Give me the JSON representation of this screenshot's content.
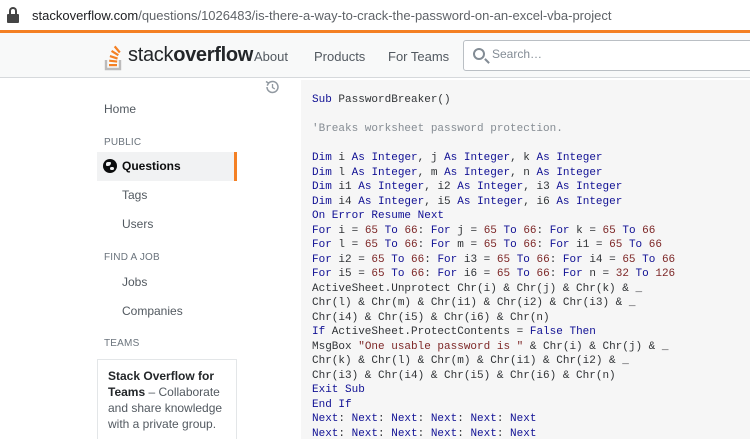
{
  "browser": {
    "url_host": "stackoverflow.com",
    "url_path": "/questions/1026483/is-there-a-way-to-crack-the-password-on-an-excel-vba-project"
  },
  "header": {
    "logo_light": "stack",
    "logo_bold": "overflow",
    "nav": [
      "About",
      "Products",
      "For Teams"
    ],
    "search_placeholder": "Search…",
    "accent": "#f48024"
  },
  "sidebar": {
    "home": "Home",
    "public_heading": "PUBLIC",
    "questions": "Questions",
    "tags": "Tags",
    "users": "Users",
    "find_job_heading": "FIND A JOB",
    "jobs": "Jobs",
    "companies": "Companies",
    "teams_heading": "TEAMS",
    "teams_title": "Stack Overflow for Teams",
    "teams_text": " – Collaborate and share knowledge with a private group."
  },
  "code_lines": [
    [
      [
        "kw",
        "Sub"
      ],
      [
        "fn",
        " PasswordBreaker()"
      ]
    ],
    [],
    [
      [
        "com",
        "'Breaks worksheet password protection."
      ]
    ],
    [],
    [
      [
        "kw",
        "Dim"
      ],
      [
        "fn",
        " i "
      ],
      [
        "kw",
        "As"
      ],
      [
        "fn",
        " "
      ],
      [
        "kw",
        "Integer"
      ],
      [
        "fn",
        ", j "
      ],
      [
        "kw",
        "As"
      ],
      [
        "fn",
        " "
      ],
      [
        "kw",
        "Integer"
      ],
      [
        "fn",
        ", k "
      ],
      [
        "kw",
        "As"
      ],
      [
        "fn",
        " "
      ],
      [
        "kw",
        "Integer"
      ]
    ],
    [
      [
        "kw",
        "Dim"
      ],
      [
        "fn",
        " l "
      ],
      [
        "kw",
        "As"
      ],
      [
        "fn",
        " "
      ],
      [
        "kw",
        "Integer"
      ],
      [
        "fn",
        ", m "
      ],
      [
        "kw",
        "As"
      ],
      [
        "fn",
        " "
      ],
      [
        "kw",
        "Integer"
      ],
      [
        "fn",
        ", n "
      ],
      [
        "kw",
        "As"
      ],
      [
        "fn",
        " "
      ],
      [
        "kw",
        "Integer"
      ]
    ],
    [
      [
        "kw",
        "Dim"
      ],
      [
        "fn",
        " i1 "
      ],
      [
        "kw",
        "As"
      ],
      [
        "fn",
        " "
      ],
      [
        "kw",
        "Integer"
      ],
      [
        "fn",
        ", i2 "
      ],
      [
        "kw",
        "As"
      ],
      [
        "fn",
        " "
      ],
      [
        "kw",
        "Integer"
      ],
      [
        "fn",
        ", i3 "
      ],
      [
        "kw",
        "As"
      ],
      [
        "fn",
        " "
      ],
      [
        "kw",
        "Integer"
      ]
    ],
    [
      [
        "kw",
        "Dim"
      ],
      [
        "fn",
        " i4 "
      ],
      [
        "kw",
        "As"
      ],
      [
        "fn",
        " "
      ],
      [
        "kw",
        "Integer"
      ],
      [
        "fn",
        ", i5 "
      ],
      [
        "kw",
        "As"
      ],
      [
        "fn",
        " "
      ],
      [
        "kw",
        "Integer"
      ],
      [
        "fn",
        ", i6 "
      ],
      [
        "kw",
        "As"
      ],
      [
        "fn",
        " "
      ],
      [
        "kw",
        "Integer"
      ]
    ],
    [
      [
        "kw",
        "On Error Resume Next"
      ]
    ],
    [
      [
        "kw",
        "For"
      ],
      [
        "fn",
        " i = "
      ],
      [
        "num",
        "65"
      ],
      [
        "fn",
        " "
      ],
      [
        "kw",
        "To"
      ],
      [
        "fn",
        " "
      ],
      [
        "num",
        "66"
      ],
      [
        "fn",
        ": "
      ],
      [
        "kw",
        "For"
      ],
      [
        "fn",
        " j = "
      ],
      [
        "num",
        "65"
      ],
      [
        "fn",
        " "
      ],
      [
        "kw",
        "To"
      ],
      [
        "fn",
        " "
      ],
      [
        "num",
        "66"
      ],
      [
        "fn",
        ": "
      ],
      [
        "kw",
        "For"
      ],
      [
        "fn",
        " k = "
      ],
      [
        "num",
        "65"
      ],
      [
        "fn",
        " "
      ],
      [
        "kw",
        "To"
      ],
      [
        "fn",
        " "
      ],
      [
        "num",
        "66"
      ]
    ],
    [
      [
        "kw",
        "For"
      ],
      [
        "fn",
        " l = "
      ],
      [
        "num",
        "65"
      ],
      [
        "fn",
        " "
      ],
      [
        "kw",
        "To"
      ],
      [
        "fn",
        " "
      ],
      [
        "num",
        "66"
      ],
      [
        "fn",
        ": "
      ],
      [
        "kw",
        "For"
      ],
      [
        "fn",
        " m = "
      ],
      [
        "num",
        "65"
      ],
      [
        "fn",
        " "
      ],
      [
        "kw",
        "To"
      ],
      [
        "fn",
        " "
      ],
      [
        "num",
        "66"
      ],
      [
        "fn",
        ": "
      ],
      [
        "kw",
        "For"
      ],
      [
        "fn",
        " i1 = "
      ],
      [
        "num",
        "65"
      ],
      [
        "fn",
        " "
      ],
      [
        "kw",
        "To"
      ],
      [
        "fn",
        " "
      ],
      [
        "num",
        "66"
      ]
    ],
    [
      [
        "kw",
        "For"
      ],
      [
        "fn",
        " i2 = "
      ],
      [
        "num",
        "65"
      ],
      [
        "fn",
        " "
      ],
      [
        "kw",
        "To"
      ],
      [
        "fn",
        " "
      ],
      [
        "num",
        "66"
      ],
      [
        "fn",
        ": "
      ],
      [
        "kw",
        "For"
      ],
      [
        "fn",
        " i3 = "
      ],
      [
        "num",
        "65"
      ],
      [
        "fn",
        " "
      ],
      [
        "kw",
        "To"
      ],
      [
        "fn",
        " "
      ],
      [
        "num",
        "66"
      ],
      [
        "fn",
        ": "
      ],
      [
        "kw",
        "For"
      ],
      [
        "fn",
        " i4 = "
      ],
      [
        "num",
        "65"
      ],
      [
        "fn",
        " "
      ],
      [
        "kw",
        "To"
      ],
      [
        "fn",
        " "
      ],
      [
        "num",
        "66"
      ]
    ],
    [
      [
        "kw",
        "For"
      ],
      [
        "fn",
        " i5 = "
      ],
      [
        "num",
        "65"
      ],
      [
        "fn",
        " "
      ],
      [
        "kw",
        "To"
      ],
      [
        "fn",
        " "
      ],
      [
        "num",
        "66"
      ],
      [
        "fn",
        ": "
      ],
      [
        "kw",
        "For"
      ],
      [
        "fn",
        " i6 = "
      ],
      [
        "num",
        "65"
      ],
      [
        "fn",
        " "
      ],
      [
        "kw",
        "To"
      ],
      [
        "fn",
        " "
      ],
      [
        "num",
        "66"
      ],
      [
        "fn",
        ": "
      ],
      [
        "kw",
        "For"
      ],
      [
        "fn",
        " n = "
      ],
      [
        "num",
        "32"
      ],
      [
        "fn",
        " "
      ],
      [
        "kw",
        "To"
      ],
      [
        "fn",
        " "
      ],
      [
        "num",
        "126"
      ]
    ],
    [
      [
        "fn",
        "ActiveSheet.Unprotect Chr(i) & Chr(j) & Chr(k) & _"
      ]
    ],
    [
      [
        "fn",
        "Chr(l) & Chr(m) & Chr(i1) & Chr(i2) & Chr(i3) & _"
      ]
    ],
    [
      [
        "fn",
        "Chr(i4) & Chr(i5) & Chr(i6) & Chr(n)"
      ]
    ],
    [
      [
        "kw",
        "If"
      ],
      [
        "fn",
        " ActiveSheet.ProtectContents = "
      ],
      [
        "kw",
        "False"
      ],
      [
        "fn",
        " "
      ],
      [
        "kw",
        "Then"
      ]
    ],
    [
      [
        "fn",
        "MsgBox "
      ],
      [
        "str",
        "\"One usable password is \""
      ],
      [
        "fn",
        " & Chr(i) & Chr(j) & _"
      ]
    ],
    [
      [
        "fn",
        "Chr(k) & Chr(l) & Chr(m) & Chr(i1) & Chr(i2) & _"
      ]
    ],
    [
      [
        "fn",
        "Chr(i3) & Chr(i4) & Chr(i5) & Chr(i6) & Chr(n)"
      ]
    ],
    [
      [
        "kw",
        "Exit Sub"
      ]
    ],
    [
      [
        "kw",
        "End If"
      ]
    ],
    [
      [
        "kw",
        "Next"
      ],
      [
        "fn",
        ": "
      ],
      [
        "kw",
        "Next"
      ],
      [
        "fn",
        ": "
      ],
      [
        "kw",
        "Next"
      ],
      [
        "fn",
        ": "
      ],
      [
        "kw",
        "Next"
      ],
      [
        "fn",
        ": "
      ],
      [
        "kw",
        "Next"
      ],
      [
        "fn",
        ": "
      ],
      [
        "kw",
        "Next"
      ]
    ],
    [
      [
        "kw",
        "Next"
      ],
      [
        "fn",
        ": "
      ],
      [
        "kw",
        "Next"
      ],
      [
        "fn",
        ": "
      ],
      [
        "kw",
        "Next"
      ],
      [
        "fn",
        ": "
      ],
      [
        "kw",
        "Next"
      ],
      [
        "fn",
        ": "
      ],
      [
        "kw",
        "Next"
      ],
      [
        "fn",
        ": "
      ],
      [
        "kw",
        "Next"
      ]
    ]
  ]
}
